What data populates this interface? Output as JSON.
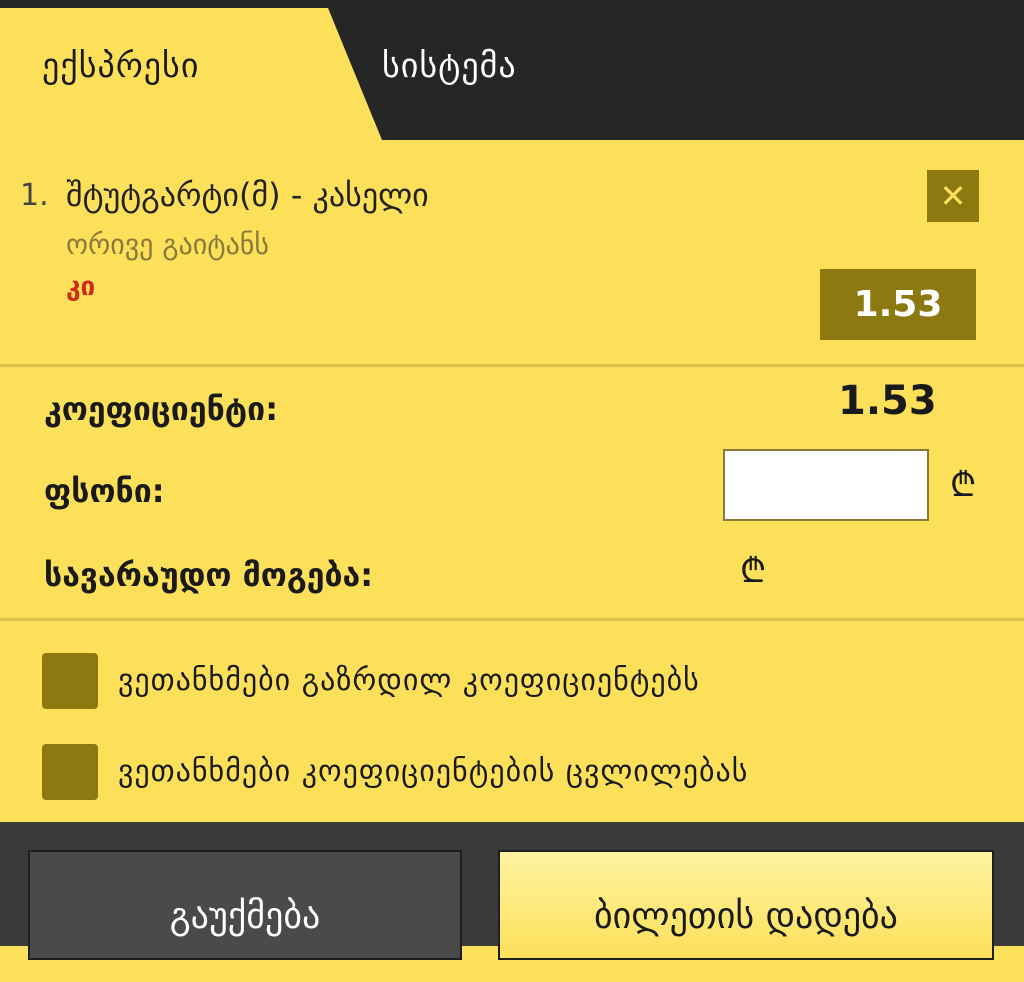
{
  "tabs": {
    "express": "ექსპრესი",
    "system": "სისტემა"
  },
  "bet": {
    "number": "1.",
    "match": "შტუტგარტი(მ) - კასელი",
    "market": "ორივე გაიტანს",
    "choice": "კი",
    "odd": "1.53",
    "close_icon": "close-icon",
    "close_glyph": "✕"
  },
  "summary": {
    "coef_label": "კოეფიციენტი:",
    "coef_value": "1.53",
    "stake_label": "ფსონი:",
    "stake_value": "",
    "win_label": "სავარაუდო მოგება:",
    "currency_symbol": "₾"
  },
  "checks": [
    {
      "label": "ვეთანხმები გაზრდილ კოეფიციენტებს",
      "checked": false
    },
    {
      "label": "ვეთანხმები კოეფიციენტების ცვლილებას",
      "checked": false
    }
  ],
  "footer": {
    "cancel": "გაუქმება",
    "place": "ბილეთის დადება"
  },
  "colors": {
    "background": "#fce05a",
    "dark": "#262626",
    "accent": "#8c7a10",
    "choice": "#d12a18"
  }
}
